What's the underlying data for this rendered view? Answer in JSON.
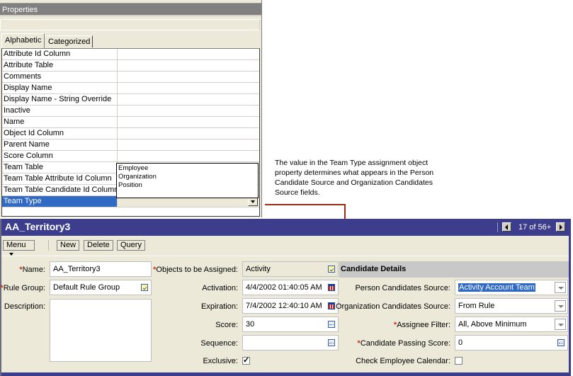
{
  "properties_panel": {
    "title": "Properties",
    "tabs": [
      {
        "label": "Alphabetic",
        "active": true
      },
      {
        "label": "Categorized",
        "active": false
      }
    ],
    "rows": [
      {
        "name": "Attribute Id Column",
        "value": ""
      },
      {
        "name": "Attribute Table",
        "value": ""
      },
      {
        "name": "Comments",
        "value": ""
      },
      {
        "name": "Display Name",
        "value": ""
      },
      {
        "name": "Display Name - String Override",
        "value": ""
      },
      {
        "name": "Inactive",
        "value": ""
      },
      {
        "name": "Name",
        "value": ""
      },
      {
        "name": "Object Id Column",
        "value": ""
      },
      {
        "name": "Parent Name",
        "value": ""
      },
      {
        "name": "Score Column",
        "value": ""
      },
      {
        "name": "Team Table",
        "value": ""
      },
      {
        "name": "Team Table Attribute Id Column",
        "value": ""
      },
      {
        "name": "Team Table Candidate Id Column",
        "value": ""
      },
      {
        "name": "Team Type",
        "value": "",
        "selected": true
      }
    ],
    "team_type_options": [
      "Employee",
      "Organization",
      "Position"
    ]
  },
  "annotation": {
    "text": "The value in the Team Type assignment object property determines what appears in the Person Candidate Source and Organization Candidates Source fields.",
    "line_color": "#9b2c14"
  },
  "applet": {
    "title": "AA_Territory3",
    "record_counter": "17 of 56+",
    "toolbar": {
      "menu_label": "Menu",
      "new_label": "New",
      "delete_label": "Delete",
      "query_label": "Query"
    },
    "fields": {
      "name": {
        "label": "Name:",
        "value": "AA_Territory3",
        "required": true
      },
      "rule_group": {
        "label": "Rule Group:",
        "value": "Default Rule Group",
        "required": true
      },
      "description": {
        "label": "Description:",
        "value": ""
      },
      "objects_to_be_assigned": {
        "label": "Objects to be Assigned:",
        "value": "Activity",
        "required": true
      },
      "activation": {
        "label": "Activation:",
        "value": "4/4/2002 01:40:05 AM"
      },
      "expiration": {
        "label": "Expiration:",
        "value": "7/4/2002 12:40:10 AM"
      },
      "score": {
        "label": "Score:",
        "value": "30"
      },
      "sequence": {
        "label": "Sequence:",
        "value": ""
      },
      "exclusive": {
        "label": "Exclusive:",
        "checked": true
      }
    },
    "candidate_details": {
      "header": "Candidate Details",
      "person_candidates_source": {
        "label": "Person Candidates Source:",
        "value": "Activity Account Team"
      },
      "organization_candidates_source": {
        "label": "Organization Candidates Source:",
        "value": "From Rule"
      },
      "assignee_filter": {
        "label": "Assignee Filter:",
        "value": "All, Above Minimum",
        "required": true
      },
      "candidate_passing_score": {
        "label": "Candidate Passing Score:",
        "value": "0",
        "required": true
      },
      "check_employee_calendar": {
        "label": "Check Employee Calendar:",
        "checked": false
      }
    },
    "required_marker": "*",
    "colors": {
      "header_bg": "#3d3d8e",
      "required": "#c8341c",
      "selection": "#316ac5"
    }
  }
}
